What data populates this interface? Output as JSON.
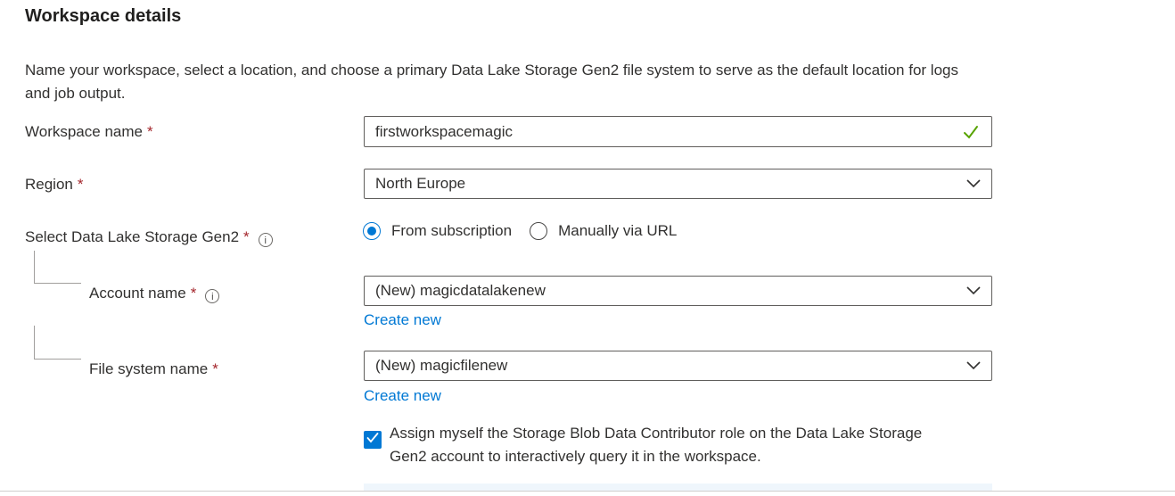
{
  "colors": {
    "accent_blue": "#0078d4",
    "valid_green": "#57a300",
    "required_red": "#a4262c",
    "banner_blue": "#eff6fc"
  },
  "header": {
    "title": "Workspace details",
    "description": "Name your workspace, select a location, and choose a primary Data Lake Storage Gen2 file system to serve as the default location for logs and job output."
  },
  "form": {
    "workspace_name": {
      "label": "Workspace name",
      "required_marker": "*",
      "value": "firstworkspacemagic",
      "validation": "valid"
    },
    "region": {
      "label": "Region",
      "required_marker": "*",
      "value": "North Europe"
    },
    "storage_source": {
      "label": "Select Data Lake Storage Gen2",
      "required_marker": "*",
      "info_icon_glyph": "i",
      "options": [
        {
          "label": "From subscription",
          "selected": true
        },
        {
          "label": "Manually via URL",
          "selected": false
        }
      ]
    },
    "account_name": {
      "label": "Account name",
      "required_marker": "*",
      "info_icon_glyph": "i",
      "value": "(New) magicdatalakenew",
      "create_new_label": "Create new"
    },
    "file_system_name": {
      "label": "File system name",
      "required_marker": "*",
      "value": "(New) magicfilenew",
      "create_new_label": "Create new"
    },
    "assign_role_checkbox": {
      "checked": true,
      "label": "Assign myself the Storage Blob Data Contributor role on the Data Lake Storage Gen2 account to interactively query it in the workspace."
    }
  }
}
